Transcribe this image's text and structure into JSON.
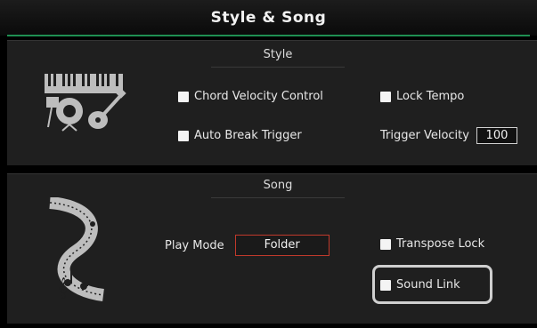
{
  "header": {
    "title": "Style & Song"
  },
  "style_section": {
    "label": "Style",
    "chord_velocity_label": "Chord Velocity Control",
    "lock_tempo_label": "Lock Tempo",
    "auto_break_label": "Auto Break Trigger",
    "trigger_velocity_label": "Trigger Velocity",
    "trigger_velocity_value": "100",
    "icon": "instruments-icon"
  },
  "song_section": {
    "label": "Song",
    "play_mode_label": "Play Mode",
    "play_mode_value": "Folder",
    "transpose_lock_label": "Transpose Lock",
    "sound_link_label": "Sound Link",
    "icon": "music-notes-icon"
  }
}
